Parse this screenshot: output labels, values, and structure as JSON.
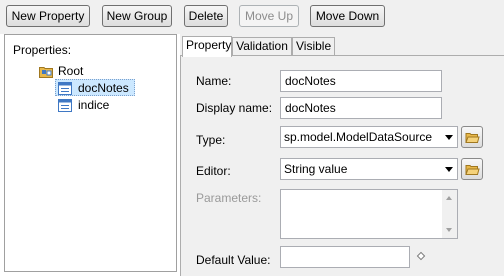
{
  "toolbar": {
    "new_property": "New Property",
    "new_group": "New Group",
    "delete": "Delete",
    "move_up": "Move Up",
    "move_down": "Move Down"
  },
  "tree": {
    "title": "Properties:",
    "root_label": "Root",
    "items": [
      {
        "label": "docNotes",
        "selected": true
      },
      {
        "label": "indice",
        "selected": false
      }
    ]
  },
  "tabs": [
    {
      "label": "Property",
      "active": true
    },
    {
      "label": "Validation",
      "active": false
    },
    {
      "label": "Visible",
      "active": false
    }
  ],
  "form": {
    "name_label": "Name:",
    "name_value": "docNotes",
    "display_name_label": "Display name:",
    "display_name_value": "docNotes",
    "type_label": "Type:",
    "type_value": "sp.model.ModelDataSource",
    "editor_label": "Editor:",
    "editor_value": "String value",
    "parameters_label": "Parameters:",
    "parameters_value": "",
    "default_value_label": "Default Value:",
    "default_value_value": ""
  },
  "icons": {
    "root": "folder-tree-icon",
    "item": "property-item-icon",
    "browse": "open-folder-icon",
    "default_marker": "diamond-icon"
  },
  "colors": {
    "selection": "#cce8ff",
    "folder": "#e8b84a",
    "item_icon": "#3f78c4"
  }
}
